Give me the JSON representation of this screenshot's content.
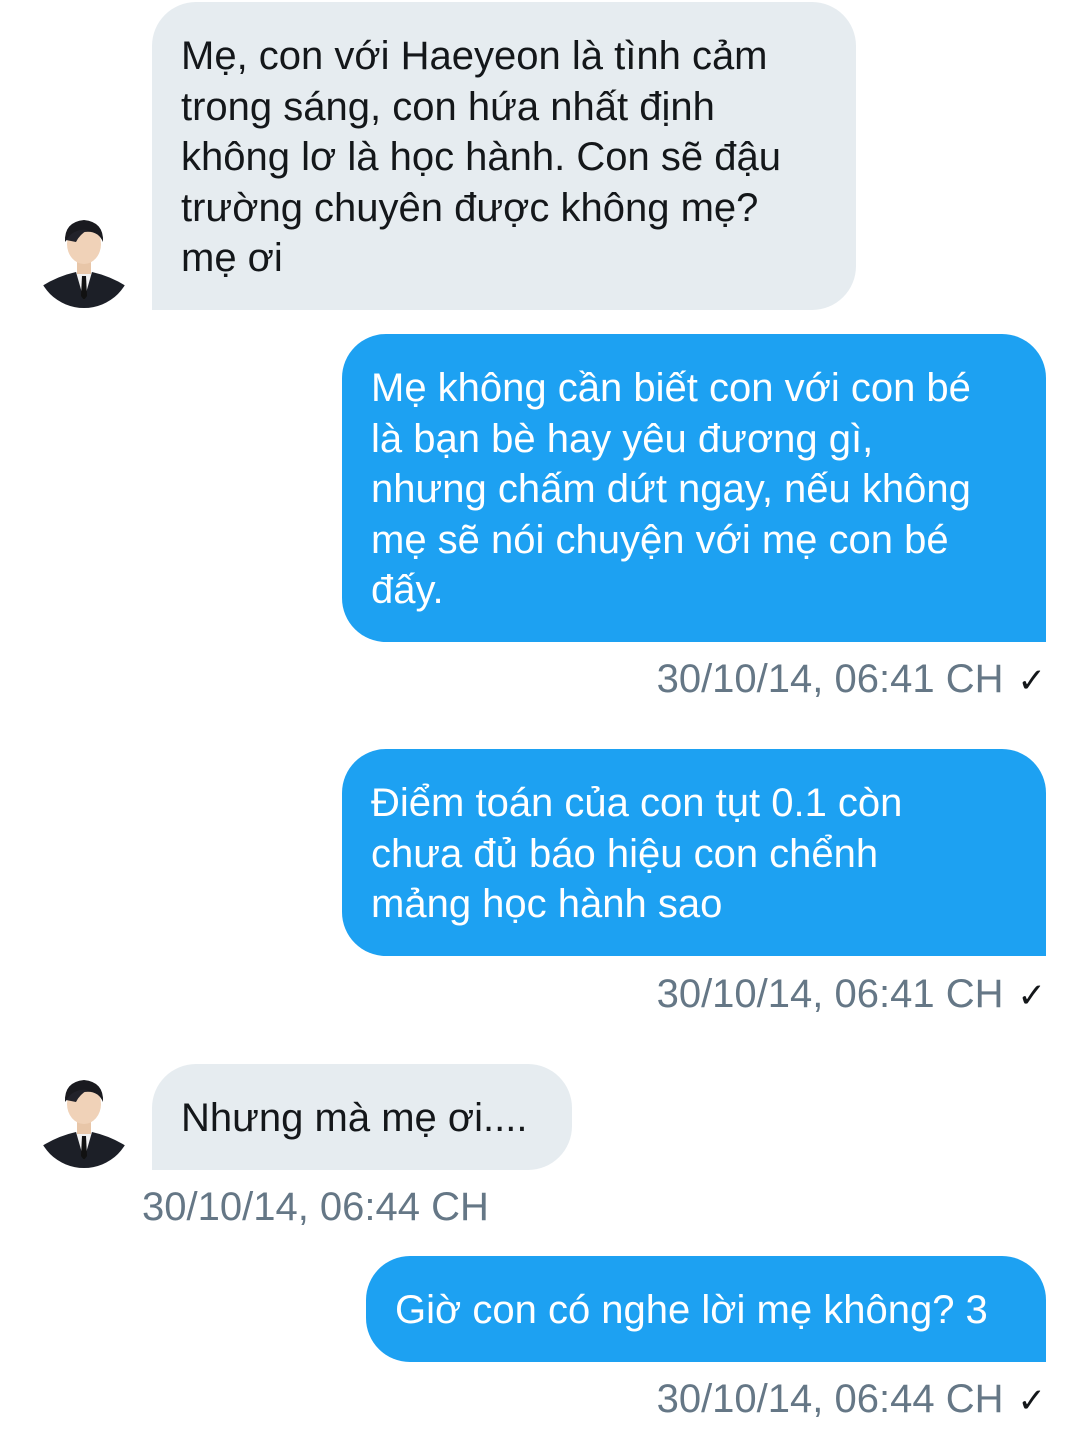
{
  "conversation": {
    "messages": [
      {
        "direction": "incoming",
        "text": "Mẹ, con với Haeyeon là tình cảm\ntrong sáng, con hứa nhất định\nkhông lơ là học hành. Con sẽ đậu\ntrường chuyên được không mẹ?\nmẹ ơi"
      },
      {
        "direction": "outgoing",
        "text": "Mẹ không cần biết con với con bé\nlà bạn bè hay yêu đương gì,\nnhưng chấm dứt ngay, nếu không\nmẹ sẽ nói chuyện với mẹ con bé\nđấy.",
        "timestamp": "30/10/14, 06:41 CH",
        "status_icon": "✓"
      },
      {
        "direction": "outgoing",
        "text": "Điểm toán của con tụt 0.1 còn\nchưa đủ báo hiệu con chểnh\nmảng học hành sao",
        "timestamp": "30/10/14, 06:41 CH",
        "status_icon": "✓"
      },
      {
        "direction": "incoming",
        "text": "Nhưng mà mẹ ơi....",
        "timestamp": "30/10/14, 06:44 CH"
      },
      {
        "direction": "outgoing",
        "text": "Giờ con có nghe lời mẹ không? 3",
        "timestamp": "30/10/14, 06:44 CH",
        "status_icon": "✓"
      }
    ]
  },
  "colors": {
    "incoming_bubble": "#e6ecf0",
    "outgoing_bubble": "#1da1f2",
    "timestamp_text": "#657786"
  },
  "icons": {
    "avatar": "contact-avatar-icon",
    "read_receipt": "checkmark-icon"
  }
}
